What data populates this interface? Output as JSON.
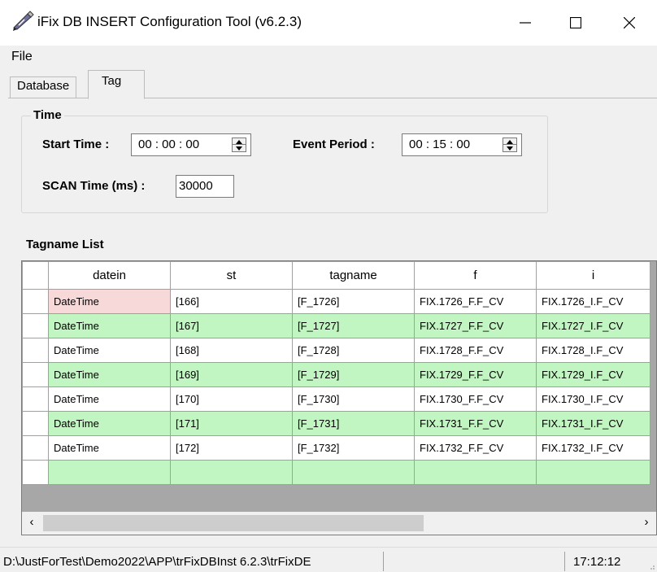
{
  "window": {
    "title": "iFix DB INSERT Configuration Tool (v6.2.3)",
    "icon": "edit-pen-icon"
  },
  "menu": {
    "file": "File"
  },
  "tabs": [
    {
      "label": "Database",
      "active": false
    },
    {
      "label": "Tag",
      "active": true
    }
  ],
  "time_group": {
    "title": "Time",
    "start_time_label": "Start Time :",
    "start_time_value": "00 : 00 : 00",
    "event_period_label": "Event Period :",
    "event_period_value": "00 : 15 : 00",
    "scan_time_label": "SCAN Time  (ms) :",
    "scan_time_value": "30000"
  },
  "grid": {
    "title": "Tagname List",
    "columns": [
      "datein",
      "st",
      "tagname",
      "f",
      "i"
    ],
    "rows": [
      [
        "DateTime",
        "[166]",
        "[F_1726]",
        "FIX.1726_F.F_CV",
        "FIX.1726_I.F_CV"
      ],
      [
        "DateTime",
        "[167]",
        "[F_1727]",
        "FIX.1727_F.F_CV",
        "FIX.1727_I.F_CV"
      ],
      [
        "DateTime",
        "[168]",
        "[F_1728]",
        "FIX.1728_F.F_CV",
        "FIX.1728_I.F_CV"
      ],
      [
        "DateTime",
        "[169]",
        "[F_1729]",
        "FIX.1729_F.F_CV",
        "FIX.1729_I.F_CV"
      ],
      [
        "DateTime",
        "[170]",
        "[F_1730]",
        "FIX.1730_F.F_CV",
        "FIX.1730_I.F_CV"
      ],
      [
        "DateTime",
        "[171]",
        "[F_1731]",
        "FIX.1731_F.F_CV",
        "FIX.1731_I.F_CV"
      ],
      [
        "DateTime",
        "[172]",
        "[F_1732]",
        "FIX.1732_F.F_CV",
        "FIX.1732_I.F_CV"
      ]
    ],
    "colors": {
      "alt_row": "#c1f5c1",
      "selected_cell": "#f8d9d9",
      "empty_area": "#a7a7a7"
    }
  },
  "statusbar": {
    "path": "D:\\JustForTest\\Demo2022\\APP\\trFixDBInst 6.2.3\\trFixDE",
    "time": "17:12:12"
  }
}
